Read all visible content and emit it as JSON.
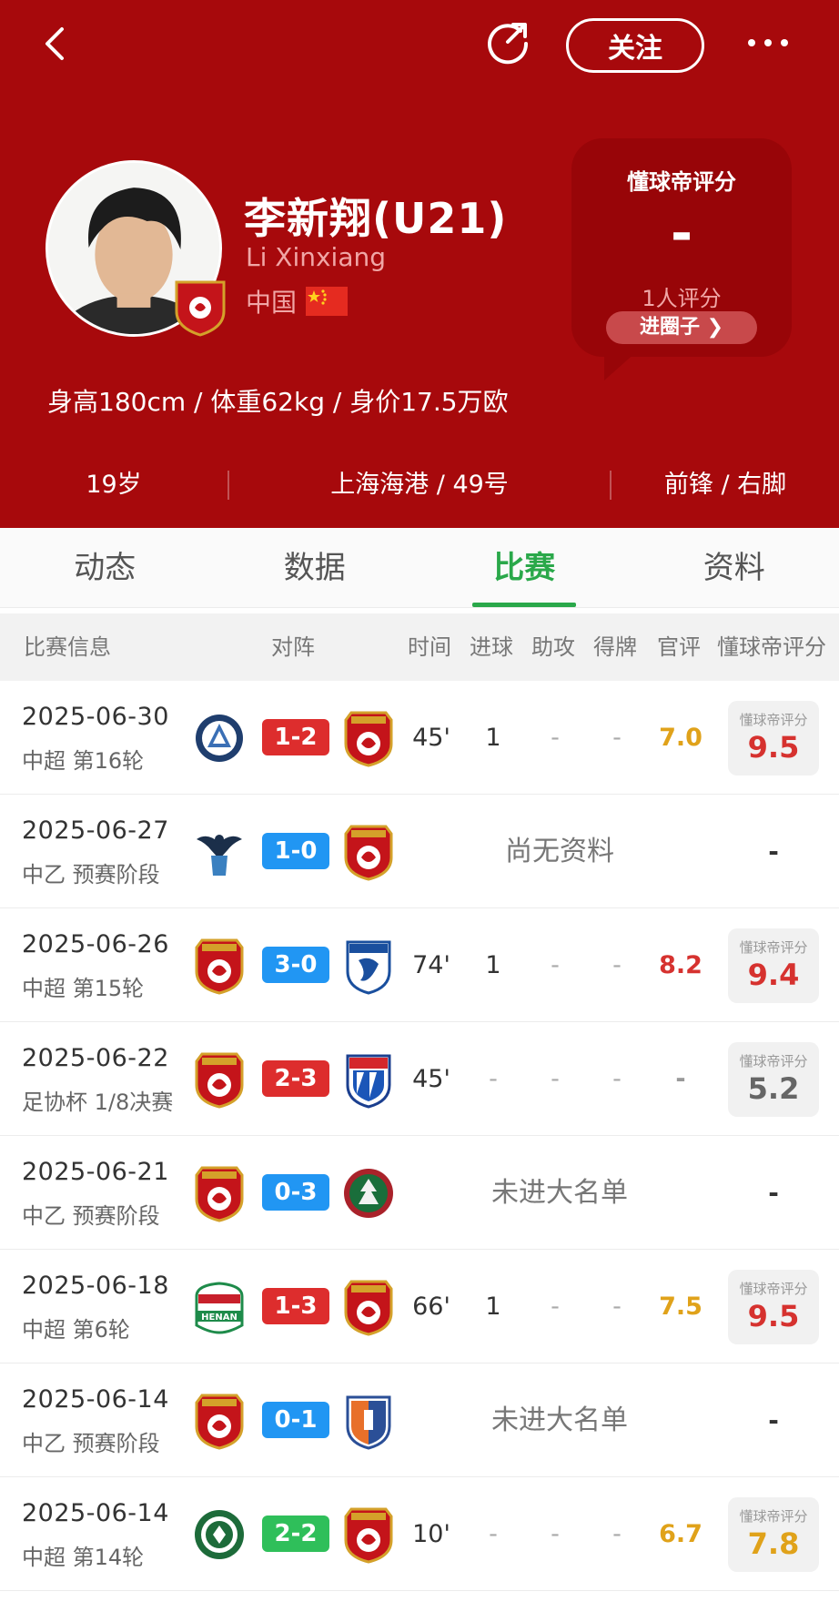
{
  "header": {
    "follow_label": "关注",
    "player_name": "李新翔(U21)",
    "player_name_en": "Li Xinxiang",
    "nationality": "中国",
    "body_info": "身高180cm / 体重62kg / 身价17.5万欧",
    "age": "19岁",
    "team_number": "上海海港 / 49号",
    "position_foot": "前锋 / 右脚",
    "brand_color": "#a7090c"
  },
  "rating_card": {
    "title": "懂球帝评分",
    "value": "-",
    "count": "1人评分",
    "join_label": "进圈子"
  },
  "tabs": [
    "动态",
    "数据",
    "比赛",
    "资料"
  ],
  "active_tab": "比赛",
  "table": {
    "headers": {
      "info": "比赛信息",
      "matchup": "对阵",
      "time": "时间",
      "goals": "进球",
      "assists": "助攻",
      "cards": "得牌",
      "official": "官评",
      "dqd": "懂球帝评分"
    },
    "rating_label": "懂球帝评分",
    "rows": [
      {
        "date": "2025-06-30",
        "comp": "中超 第16轮",
        "score": "1-2",
        "result": "loss",
        "home": "nantong",
        "away": "haigang",
        "time": "45'",
        "goals": "1",
        "assists": "-",
        "cards": "-",
        "official": "7.0",
        "official_color": "#e0a21a",
        "dqd": "9.5",
        "dqd_color": "#d6322f"
      },
      {
        "date": "2025-06-27",
        "comp": "中乙 预赛阶段",
        "score": "1-0",
        "result": "win",
        "home": "bird",
        "away": "haigang",
        "notice": "尚无资料",
        "dqd_none": "-"
      },
      {
        "date": "2025-06-26",
        "comp": "中超 第15轮",
        "score": "3-0",
        "result": "win",
        "home": "haigang",
        "away": "dalian",
        "time": "74'",
        "goals": "1",
        "assists": "-",
        "cards": "-",
        "official": "8.2",
        "official_color": "#d6322f",
        "dqd": "9.4",
        "dqd_color": "#d6322f"
      },
      {
        "date": "2025-06-22",
        "comp": "足协杯 1/8决赛",
        "score": "2-3",
        "result": "loss",
        "home": "haigang",
        "away": "shenhua",
        "time": "45'",
        "goals": "-",
        "assists": "-",
        "cards": "-",
        "official": "-",
        "official_color": "#999999",
        "dqd": "5.2",
        "dqd_color": "#666666"
      },
      {
        "date": "2025-06-21",
        "comp": "中乙 预赛阶段",
        "score": "0-3",
        "result": "win",
        "home": "haigang",
        "away": "greenpalm",
        "notice": "未进大名单",
        "dqd_none": "-"
      },
      {
        "date": "2025-06-18",
        "comp": "中超 第6轮",
        "score": "1-3",
        "result": "loss",
        "home": "henan",
        "away": "haigang",
        "time": "66'",
        "goals": "1",
        "assists": "-",
        "cards": "-",
        "official": "7.5",
        "official_color": "#e0a21a",
        "dqd": "9.5",
        "dqd_color": "#d6322f"
      },
      {
        "date": "2025-06-14",
        "comp": "中乙 预赛阶段",
        "score": "0-1",
        "result": "win",
        "home": "haigang",
        "away": "orangeblue",
        "notice": "未进大名单",
        "dqd_none": "-"
      },
      {
        "date": "2025-06-14",
        "comp": "中超 第14轮",
        "score": "2-2",
        "result": "draw",
        "home": "zhejiang",
        "away": "haigang",
        "time": "10'",
        "goals": "-",
        "assists": "-",
        "cards": "-",
        "official": "6.7",
        "official_color": "#e0a21a",
        "dqd": "7.8",
        "dqd_color": "#e0a21a"
      }
    ]
  },
  "result_colors": {
    "loss": "#dd2d2d",
    "win": "#2196f3",
    "draw": "#2fbf5a"
  }
}
